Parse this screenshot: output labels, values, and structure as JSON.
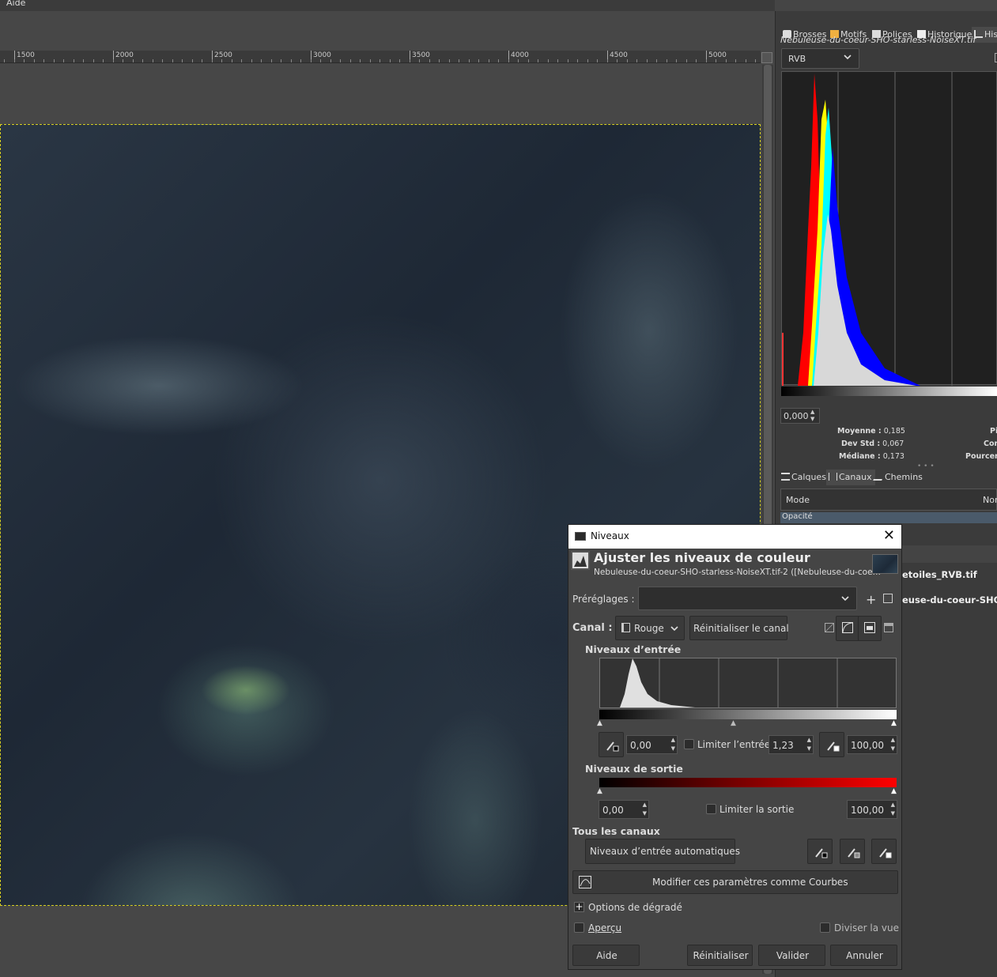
{
  "menubar": {
    "help": "Aide"
  },
  "ruler": {
    "ticks": [
      "1500",
      "2000",
      "2500",
      "3000",
      "3500",
      "4000",
      "4500",
      "5000"
    ]
  },
  "dock": {
    "tabs": [
      "Brosses",
      "Motifs",
      "Polices",
      "Historique",
      "His"
    ],
    "filename": "Nebuleuse-du-coeur-SHO-starless-NoiseXT.tif",
    "channel": "RVB",
    "range_start": "0,000",
    "stats": {
      "mean_label": "Moyenne :",
      "mean": "0,185",
      "std_label": "Dev Std :",
      "std": "0,067",
      "median_label": "Médiane :",
      "median": "0,173",
      "r1": "Pi",
      "r2": "Cor",
      "r3": "Pourcent"
    },
    "layer_tabs": [
      "Calques",
      "Canaux",
      "Chemins"
    ],
    "mode_label": "Mode",
    "mode_value": "Nor",
    "opacity_label": "Opacité",
    "layers": [
      "etoiles_RVB.tif",
      "euse-du-coeur-SHO-st"
    ]
  },
  "dialog": {
    "window_title": "Niveaux",
    "heading": "Ajuster les niveaux de couleur",
    "subheading": "Nebuleuse-du-coeur-SHO-starless-NoiseXT.tif-2 ([Nebuleuse-du-coe…",
    "presets_label": "Préréglages :",
    "presets_value": "",
    "channel_label": "Canal :",
    "channel_value": "Rouge",
    "reset_channel": "Réinitialiser le canal",
    "input_levels_title": "Niveaux d’entrée",
    "input_low": "0,00",
    "clamp_input": "Limiter l’entrée",
    "input_gamma": "1,23",
    "input_high": "100,00",
    "output_levels_title": "Niveaux de sortie",
    "output_low": "0,00",
    "clamp_output": "Limiter la sortie",
    "output_high": "100,00",
    "all_channels": "Tous les canaux",
    "auto_input": "Niveaux d’entrée automatiques",
    "edit_as_curves": "Modifier ces paramètres comme Courbes",
    "blending_options": "Options de dégradé",
    "preview": "Aperçu",
    "split_view": "Diviser la vue",
    "help": "Aide",
    "reset": "Réinitialiser",
    "ok": "Valider",
    "cancel": "Annuler"
  }
}
